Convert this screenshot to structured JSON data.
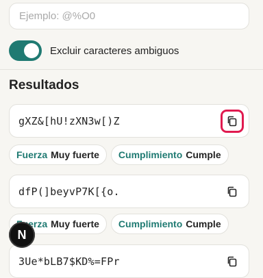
{
  "exclude": {
    "placeholder": "Ejemplo: @%O0"
  },
  "toggle": {
    "label": "Excluir caracteres ambiguos",
    "on": true
  },
  "results": {
    "title": "Resultados",
    "items": [
      {
        "password": "gXZ&[hU!zXN3w[)Z",
        "strength_key": "Fuerza",
        "strength_value": "Muy fuerte",
        "compliance_key": "Cumplimiento",
        "compliance_value": "Cumple"
      },
      {
        "password": "dfP(]beyvP7K[{o.",
        "strength_key": "Fuerza",
        "strength_value": "Muy fuerte",
        "compliance_key": "Cumplimiento",
        "compliance_value": "Cumple"
      },
      {
        "password": "3Ue*bLB7$KD%=FPr"
      }
    ]
  },
  "fab": {
    "label": "N"
  },
  "colors": {
    "accent": "#1f7a72",
    "focus_ring": "#e01a4f"
  }
}
